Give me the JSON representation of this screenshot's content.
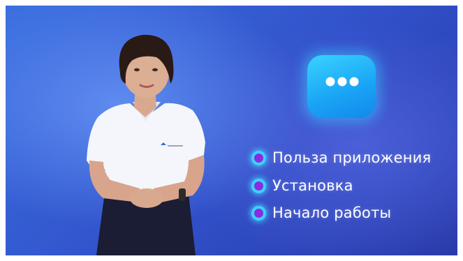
{
  "scene": {
    "background_color": "#3a5fd6",
    "accent_color": "#3fd0ff",
    "bullet_color": "#8a2be2",
    "app_icon": "chat-bubble-icon"
  },
  "topics": [
    {
      "label": "Польза приложения"
    },
    {
      "label": "Установка"
    },
    {
      "label": "Начало работы"
    }
  ]
}
